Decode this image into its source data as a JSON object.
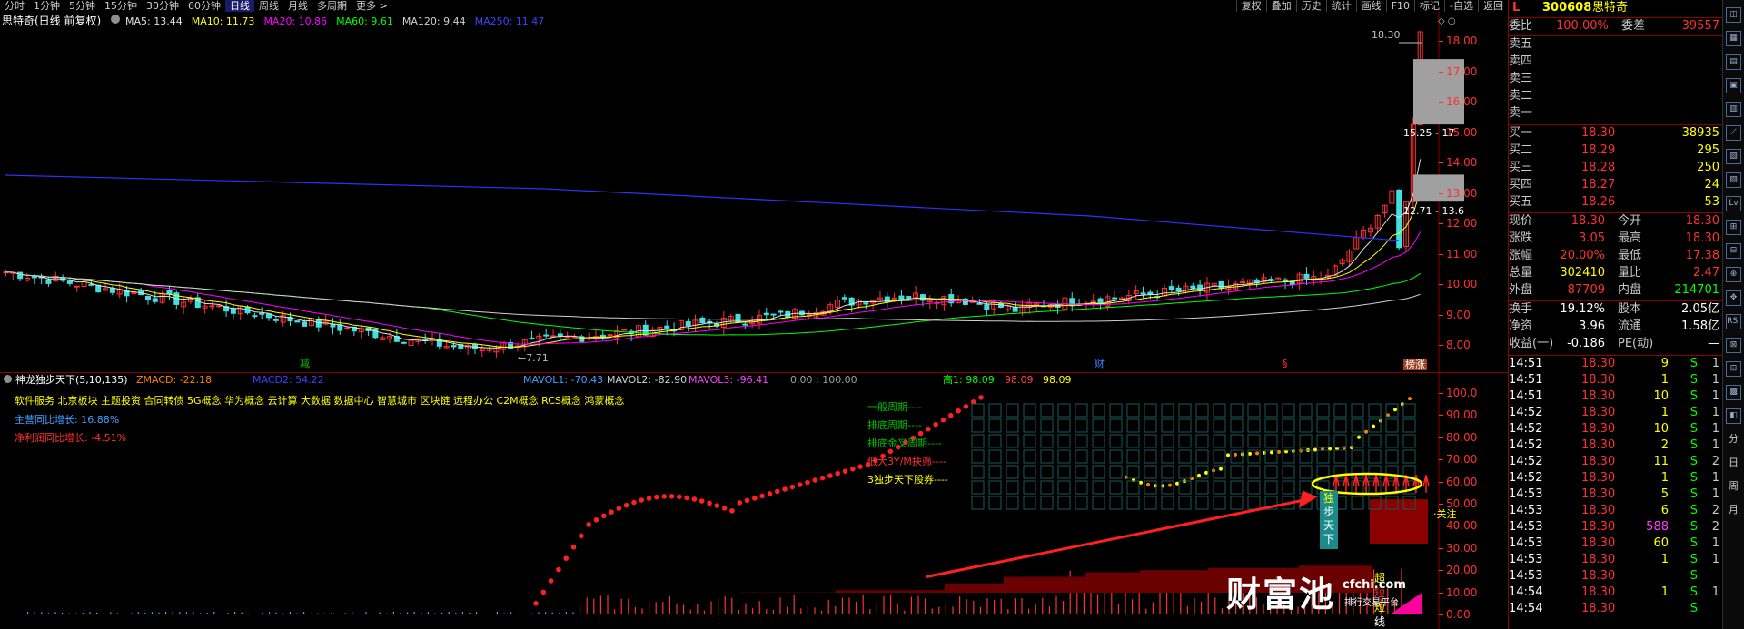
{
  "toolbar": {
    "periods": [
      "分时",
      "1分钟",
      "5分钟",
      "15分钟",
      "30分钟",
      "60分钟",
      "日线",
      "周线",
      "月线",
      "多周期",
      "更多 >"
    ],
    "active_period": "日线",
    "right_tools": [
      "复权",
      "叠加",
      "历史",
      "统计",
      "画线",
      "F10",
      "标记",
      "-自选",
      "返回"
    ]
  },
  "main_chart": {
    "title": "思特奇(日线 前复权)",
    "ma_labels": [
      {
        "text": "MA5: 13.44",
        "color": "#e0e0e0"
      },
      {
        "text": "MA10: 11.73",
        "color": "#ffff00"
      },
      {
        "text": "MA20: 10.86",
        "color": "#ff00ff"
      },
      {
        "text": "MA60: 9.61",
        "color": "#00ff00"
      },
      {
        "text": "MA120: 9.44",
        "color": "#d0d0d0"
      },
      {
        "text": "MA250: 11.47",
        "color": "#4040ff"
      }
    ],
    "price_axis": [
      "18.00",
      "17.00",
      "16.00",
      "15.00",
      "14.00",
      "13.00",
      "12.00",
      "11.00",
      "10.00",
      "9.00",
      "8.00"
    ],
    "annotations": {
      "high_label": "18.30",
      "low_label": "←7.71",
      "gap_upper_label": "15.25 - 17",
      "gap_lower_label": "12.71 - 13.6",
      "event_marks": [
        "减",
        "财",
        "§",
        "榜涨"
      ]
    }
  },
  "indicator": {
    "title": "神龙独步天下(5,10,135)",
    "values": [
      {
        "text": "ZMACD: -22.18",
        "color": "#ff8000"
      },
      {
        "text": "MACD2: 54.22",
        "color": "#4040ff"
      },
      {
        "text": "MAVOL1: -70.43",
        "color": "#40a0ff"
      },
      {
        "text": "MAVOL2: -82.90",
        "color": "#d0d0d0"
      },
      {
        "text": "MAVOL3: -96.41",
        "color": "#ff40ff"
      },
      {
        "text": "0.00 : 100.00",
        "color": "#a0a0a0"
      },
      {
        "text": "高1: 98.09",
        "color": "#00ff00"
      },
      {
        "text": "98.09",
        "color": "#ff4040"
      },
      {
        "text": "98.09",
        "color": "#ffff00"
      }
    ],
    "concepts": "软件服务 北京板块 主题投资 合同转债 5G概念 华为概念 云计算 大数据 数据中心 智慧城市 区块链 远程办公 C2M概念 RCS概念 鸿蒙概念",
    "revenue_growth": "主营同比增长: 16.88%",
    "profit_growth": "净利润同比增长: -4.51%",
    "period_labels": [
      "一般周期----",
      "排底周期----",
      "排底金叉周期----",
      "低大3Y/M抉筛----",
      "3独步天下股券----"
    ],
    "axis": [
      "100.0",
      "90.00",
      "80.00",
      "70.00",
      "60.00",
      "50.00",
      "40.00",
      "30.00",
      "20.00",
      "10.00",
      "0.00"
    ],
    "signal_chars": [
      "独",
      "步",
      "天",
      "下"
    ],
    "attention_label": "关注",
    "vertical_chars": [
      "超",
      "短",
      "短",
      "线"
    ]
  },
  "watermark": {
    "brand": "财富池",
    "site": "cfchi.com",
    "tagline": "排行交易平台"
  },
  "quote": {
    "code": "300608",
    "name": "思特奇",
    "flag": "L",
    "weibi_label": "委比",
    "weibi_value": "100.00%",
    "weicha_label": "委差",
    "weicha_value": "39557",
    "asks": [
      "卖五",
      "卖四",
      "卖三",
      "卖二",
      "卖一"
    ],
    "bids": [
      {
        "label": "买一",
        "price": "18.30",
        "vol": "38935"
      },
      {
        "label": "买二",
        "price": "18.29",
        "vol": "295"
      },
      {
        "label": "买三",
        "price": "18.28",
        "vol": "250"
      },
      {
        "label": "买四",
        "price": "18.27",
        "vol": "24"
      },
      {
        "label": "买五",
        "price": "18.26",
        "vol": "53"
      }
    ],
    "stats": [
      {
        "l1": "现价",
        "v1": "18.30",
        "c1": "#ff3030",
        "l2": "今开",
        "v2": "18.30",
        "c2": "#ff3030"
      },
      {
        "l1": "涨跌",
        "v1": "3.05",
        "c1": "#ff3030",
        "l2": "最高",
        "v2": "18.30",
        "c2": "#ff3030"
      },
      {
        "l1": "涨幅",
        "v1": "20.00%",
        "c1": "#ff3030",
        "l2": "最低",
        "v2": "17.38",
        "c2": "#ff3030"
      },
      {
        "l1": "总量",
        "v1": "302410",
        "c1": "#ffff00",
        "l2": "量比",
        "v2": "2.47",
        "c2": "#ff3030"
      },
      {
        "l1": "外盘",
        "v1": "87709",
        "c1": "#ff3030",
        "l2": "内盘",
        "v2": "214701",
        "c2": "#00ff00"
      }
    ],
    "stats2": [
      {
        "l1": "换手",
        "v1": "19.12%",
        "l2": "股本",
        "v2": "2.05亿"
      },
      {
        "l1": "净资",
        "v1": "3.96",
        "l2": "流通",
        "v2": "1.58亿"
      },
      {
        "l1": "收益(一)",
        "v1": "-0.186",
        "l2": "PE(动)",
        "v2": "—"
      }
    ],
    "ticks": [
      {
        "t": "14:51",
        "p": "18.30",
        "v": "9",
        "vc": "#ffff00",
        "s": "S",
        "n": "1"
      },
      {
        "t": "14:51",
        "p": "18.30",
        "v": "1",
        "vc": "#ffff00",
        "s": "S",
        "n": "1"
      },
      {
        "t": "14:51",
        "p": "18.30",
        "v": "10",
        "vc": "#ffff00",
        "s": "S",
        "n": "1"
      },
      {
        "t": "14:52",
        "p": "18.30",
        "v": "1",
        "vc": "#ffff00",
        "s": "S",
        "n": "1"
      },
      {
        "t": "14:52",
        "p": "18.30",
        "v": "10",
        "vc": "#ffff00",
        "s": "S",
        "n": "1"
      },
      {
        "t": "14:52",
        "p": "18.30",
        "v": "2",
        "vc": "#ffff00",
        "s": "S",
        "n": "1"
      },
      {
        "t": "14:52",
        "p": "18.30",
        "v": "11",
        "vc": "#ffff00",
        "s": "S",
        "n": "2"
      },
      {
        "t": "14:52",
        "p": "18.30",
        "v": "1",
        "vc": "#ffff00",
        "s": "S",
        "n": "1"
      },
      {
        "t": "14:53",
        "p": "18.30",
        "v": "5",
        "vc": "#ffff00",
        "s": "S",
        "n": "1"
      },
      {
        "t": "14:53",
        "p": "18.30",
        "v": "6",
        "vc": "#ffff00",
        "s": "S",
        "n": "2"
      },
      {
        "t": "14:53",
        "p": "18.30",
        "v": "588",
        "vc": "#ff40ff",
        "s": "S",
        "n": "2"
      },
      {
        "t": "14:53",
        "p": "18.30",
        "v": "60",
        "vc": "#ffff00",
        "s": "S",
        "n": "1"
      },
      {
        "t": "14:53",
        "p": "18.30",
        "v": "1",
        "vc": "#ffff00",
        "s": "S",
        "n": "1"
      },
      {
        "t": "14:53",
        "p": "18.30",
        "v": "",
        "vc": "#ffff00",
        "s": "S",
        "n": ""
      },
      {
        "t": "14:54",
        "p": "18.30",
        "v": "1",
        "vc": "#ffff00",
        "s": "S",
        "n": "1"
      },
      {
        "t": "14:54",
        "p": "18.30",
        "v": "",
        "vc": "#ffff00",
        "s": "S",
        "n": ""
      }
    ]
  },
  "side_icons": [
    "◫",
    "▦",
    "▤",
    "▣",
    "▥",
    "⟋",
    "▧",
    "▨",
    "Lv",
    "⊞",
    "⊟",
    "⊕",
    "✥",
    "RSI",
    "⊠",
    "⊡",
    "▩",
    "◧",
    "分",
    "日",
    "周",
    "月"
  ]
}
